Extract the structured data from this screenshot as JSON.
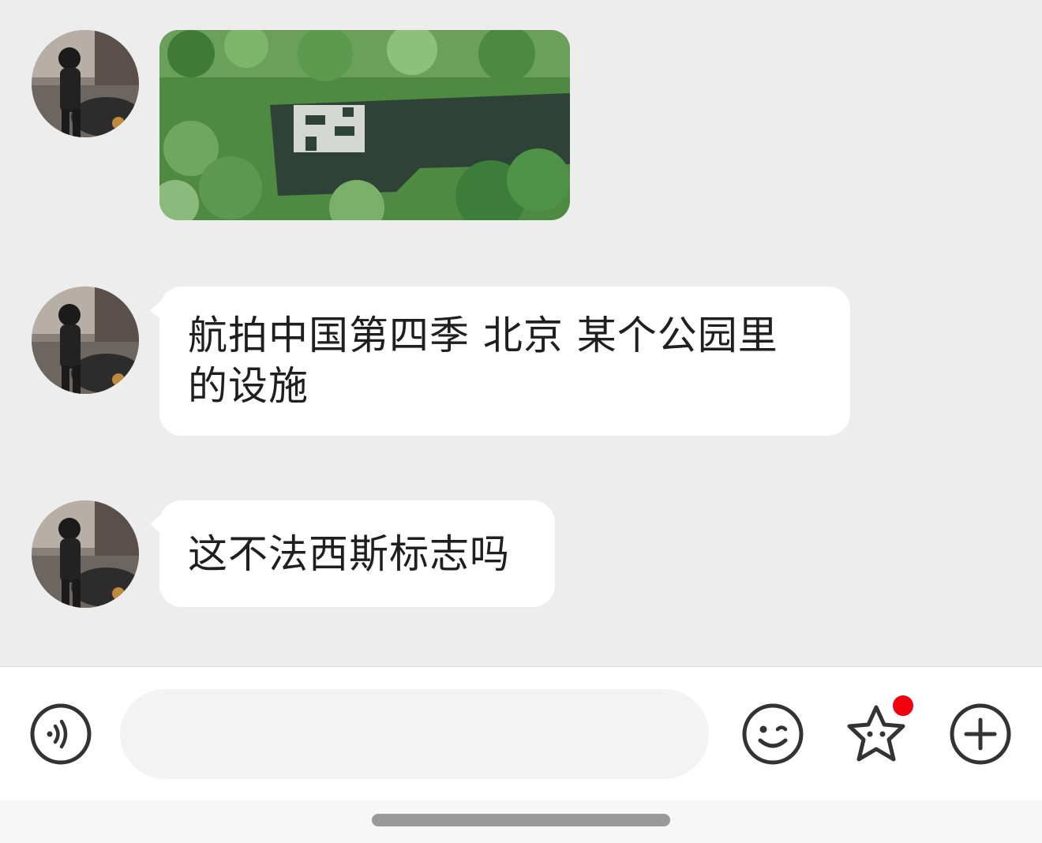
{
  "messages": [
    {
      "type": "image",
      "content_description_icon": "aerial-park-photo"
    },
    {
      "type": "text",
      "line1": "航拍中国第四季 北京  某个公园里",
      "line2": "的设施"
    },
    {
      "type": "text",
      "line1": "这不法西斯标志吗"
    }
  ],
  "input": {
    "placeholder": "",
    "value": ""
  },
  "icons": {
    "voice": "voice-icon",
    "emoji": "emoji-icon",
    "sticker": "sticker-star-icon",
    "plus": "plus-icon"
  },
  "colors": {
    "chat_bg": "#ededed",
    "bubble_bg": "#ffffff",
    "badge": "#f2000f"
  }
}
